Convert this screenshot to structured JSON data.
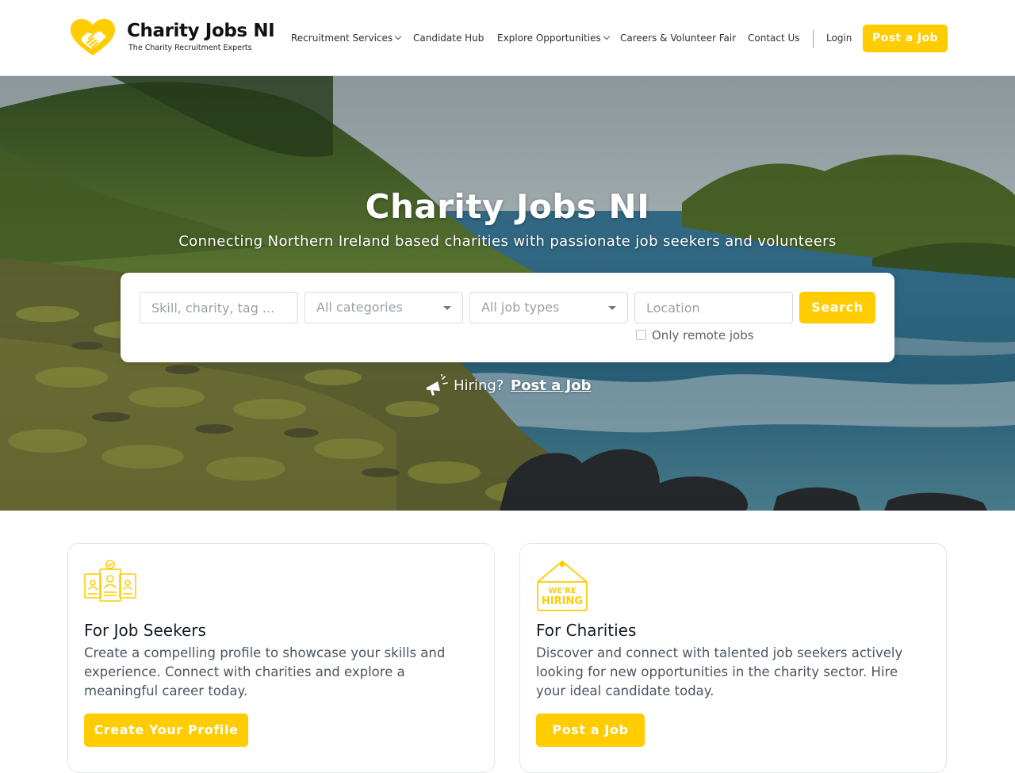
{
  "brand": {
    "name": "Charity Jobs NI",
    "tagline": "The Charity Recruitment Experts",
    "accent_color": "#FFCC00"
  },
  "nav": {
    "items": [
      {
        "label": "Recruitment Services",
        "has_dropdown": true
      },
      {
        "label": "Candidate Hub",
        "has_dropdown": false
      },
      {
        "label": "Explore Opportunities",
        "has_dropdown": true
      },
      {
        "label": "Careers & Volunteer Fair",
        "has_dropdown": false
      },
      {
        "label": "Contact Us",
        "has_dropdown": false
      }
    ],
    "login_label": "Login",
    "post_job_label": "Post a Job"
  },
  "hero": {
    "title": "Charity Jobs NI",
    "subtitle": "Connecting Northern Ireland based charities with passionate job seekers and volunteers",
    "search": {
      "keyword_placeholder": "Skill, charity, tag ...",
      "category_value": "All categories",
      "job_type_value": "All job types",
      "location_placeholder": "Location",
      "search_label": "Search",
      "remote_label": "Only remote jobs",
      "remote_checked": false
    },
    "hiring_text": "Hiring?",
    "hiring_link": "Post a Job"
  },
  "cards": [
    {
      "icon": "candidate-profiles-icon",
      "title": "For Job Seekers",
      "text": "Create a compelling profile to showcase your skills and experience. Connect with charities and explore a meaningful career today.",
      "button": "Create Your Profile"
    },
    {
      "icon": "were-hiring-sign-icon",
      "title": "For Charities",
      "text": "Discover and connect with talented job seekers actively looking for new opportunities in the charity sector. Hire your ideal candidate today.",
      "button": "Post a Job",
      "sign_text": [
        "WE'RE",
        "HIRING"
      ]
    }
  ]
}
